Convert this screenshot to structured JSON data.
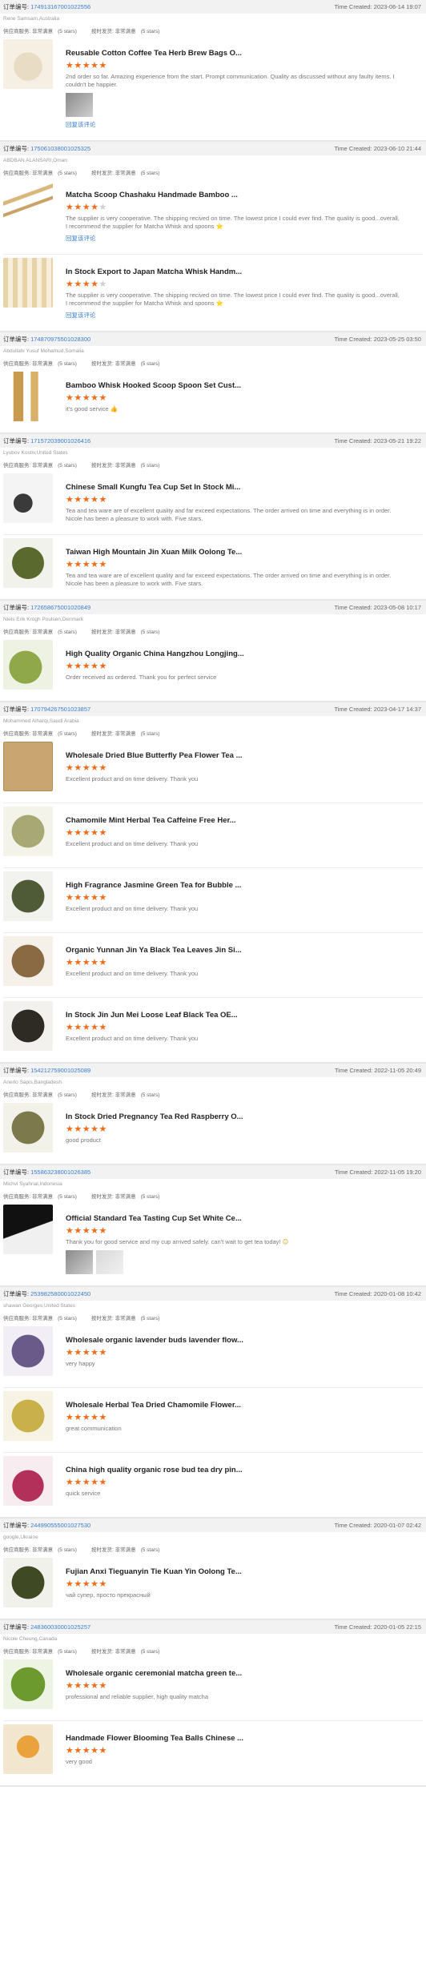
{
  "labels": {
    "order_no": "订单编号:",
    "time_created": "Time Created:",
    "supplier_service": "供应商服务: 非常满意",
    "on_time": "按时发货: 非常满意",
    "stars5": "(5 stars)",
    "reply": "回复该评论"
  },
  "orders": [
    {
      "id": "174913167001022556",
      "time": "2023-06-14 19:07",
      "buyer": "Rene Samsam,Australia",
      "items": [
        {
          "title": "Reusable Cotton Coffee Tea Herb Brew Bags O...",
          "rating": 5,
          "review": "2nd order so far. Amazing experience from the start. Prompt communication. Quality as discussed without any faulty items. I couldn't be happier.",
          "photo": true,
          "reply": true,
          "thumb": "bag"
        }
      ]
    },
    {
      "id": "175061038001025325",
      "time": "2023-06-10 21:44",
      "buyer": "ABDBAN ALANSARI,Oman",
      "items": [
        {
          "title": "Matcha Scoop Chashaku Handmade Bamboo ...",
          "rating": 4,
          "review": "The supplier is very cooperative. The shipping recived on time. The lowest price I could ever find. The quality is good...overall, I recommend the supplier for Matcha Whisk and spoons",
          "emoji": "⭐",
          "reply": true,
          "thumb": "scoop"
        },
        {
          "title": "In Stock Export to Japan Matcha Whisk Handm...",
          "rating": 4,
          "review": "The supplier is very cooperative. The shipping recived on time. The lowest price I could ever find. The quality is good...overall, I recommend the supplier for Matcha Whisk and spoons",
          "emoji": "⭐",
          "reply": true,
          "thumb": "whisk"
        }
      ]
    },
    {
      "id": "174870975501028300",
      "time": "2023-05-25 03:50",
      "buyer": "Abdullahi Yusuf Mohamud,Somalia",
      "items": [
        {
          "title": "Bamboo Whisk Hooked Scoop Spoon Set Cust...",
          "rating": 5,
          "review": "it's good service",
          "emoji": "👍",
          "thumb": "set"
        }
      ]
    },
    {
      "id": "171572039001026416",
      "time": "2023-05-21 19:22",
      "buyer": "Lyubov Kostiv,United States",
      "items": [
        {
          "title": "Chinese Small Kungfu Tea Cup Set In Stock Mi...",
          "rating": 5,
          "review": "Tea and tea ware are of excellent quality and far exceed expectations. The order arrived on time and everything is in order. Nicole has been a pleasure to work with. Five stars.",
          "thumb": "teaset"
        },
        {
          "title": "Taiwan High Mountain Jin Xuan Milk Oolong Te...",
          "rating": 5,
          "review": "Tea and tea ware are of excellent quality and far exceed expectations. The order arrived on time and everything is in order. Nicole has been a pleasure to work with. Five stars.",
          "thumb": "oolong"
        }
      ]
    },
    {
      "id": "172658675001020849",
      "time": "2023-05-08 10:17",
      "buyer": "Niels Erik Krogh Poulsen,Denmark",
      "items": [
        {
          "title": "High Quality Organic China Hangzhou Longjing...",
          "rating": 5,
          "review": "Order received as ordered. Thank you for perfect service",
          "thumb": "green"
        }
      ]
    },
    {
      "id": "170794267501023857",
      "time": "2023-04-17 14:37",
      "buyer": "Mohammed Alharqi,Saudi Arabia",
      "items": [
        {
          "title": "Wholesale Dried Blue Butterfly Pea Flower Tea ...",
          "rating": 5,
          "review": "Excellent product and on time delivery. Thank you",
          "thumb": "kraft"
        },
        {
          "title": "Chamomile Mint Herbal Tea Caffeine Free Her...",
          "rating": 5,
          "review": "Excellent product and on time delivery. Thank you",
          "thumb": "herbal"
        },
        {
          "title": "High Fragrance Jasmine Green Tea for Bubble ...",
          "rating": 5,
          "review": "Excellent product and on time delivery. Thank you",
          "thumb": "jasmine"
        },
        {
          "title": "Organic Yunnan Jin Ya Black Tea Leaves Jin Si...",
          "rating": 5,
          "review": "Excellent product and on time delivery. Thank you",
          "thumb": "blacktea"
        },
        {
          "title": "In Stock Jin Jun Mei Loose Leaf Black Tea OE...",
          "rating": 5,
          "review": "Excellent product and on time delivery. Thank you",
          "thumb": "jinjun"
        }
      ]
    },
    {
      "id": "154212759001025089",
      "time": "2022-11-05 20:49",
      "buyer": "Anerlo Sapis,Bangladesh",
      "items": [
        {
          "title": "In Stock Dried Pregnancy Tea Red Raspberry O...",
          "rating": 5,
          "review": "good product",
          "thumb": "raspberry"
        }
      ]
    },
    {
      "id": "155863238001026385",
      "time": "2022-11-05 19:20",
      "buyer": "Michvi Syahrial,Indonesia",
      "items": [
        {
          "title": "Official Standard Tea Tasting Cup Set White Ce...",
          "rating": 5,
          "review": "Thank you for good service and my cup arrived safely. can't wait to get tea today!",
          "emoji": "😊",
          "photos": 2,
          "thumb": "tasting"
        }
      ]
    },
    {
      "id": "253982580001022450",
      "time": "2020-01-08 10:42",
      "buyer": "shawan Georges,United States",
      "items": [
        {
          "title": "Wholesale organic lavender buds lavender flow...",
          "rating": 5,
          "review": "very happy",
          "thumb": "lavender"
        },
        {
          "title": "Wholesale Herbal Tea Dried Chamomile Flower...",
          "rating": 5,
          "review": "great communication",
          "thumb": "chamomile"
        },
        {
          "title": "China high quality organic rose bud tea dry pin...",
          "rating": 5,
          "review": "quick service",
          "thumb": "rose"
        }
      ]
    },
    {
      "id": "244990555001027530",
      "time": "2020-01-07 02:42",
      "buyer": "google,Ukraine",
      "items": [
        {
          "title": "Fujian Anxi Tieguanyin Tie Kuan Yin Oolong Te...",
          "rating": 5,
          "review": "чай супер, просто прекрасный",
          "thumb": "tgy"
        }
      ]
    },
    {
      "id": "248360030001025257",
      "time": "2020-01-05 22:15",
      "buyer": "Nicole Cheung,Canada",
      "items": [
        {
          "title": "Wholesale organic ceremonial matcha green te...",
          "rating": 5,
          "review": "professional and reliable supplier, high quality matcha",
          "thumb": "matcha"
        },
        {
          "title": "Handmade Flower Blooming Tea Balls Chinese ...",
          "rating": 5,
          "review": "very good",
          "thumb": "bloom"
        }
      ]
    }
  ]
}
